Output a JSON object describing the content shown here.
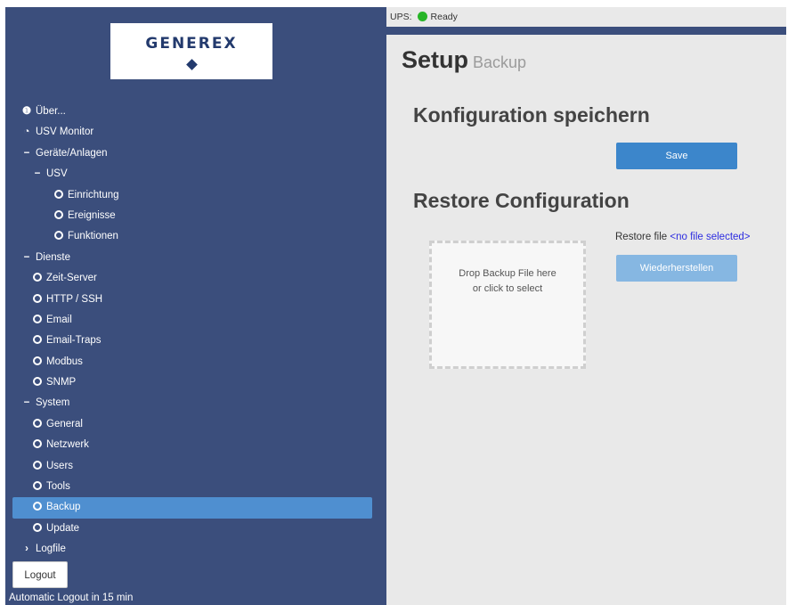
{
  "brand": {
    "logo_text": "GENEREX"
  },
  "sidebar": {
    "items": [
      {
        "label": "Über...",
        "icon": "info-icon"
      },
      {
        "label": "USV Monitor",
        "icon": "dashboard-icon"
      },
      {
        "label": "Geräte/Anlagen",
        "icon": "minus-icon"
      },
      {
        "label": "USV",
        "icon": "minus-icon"
      },
      {
        "label": "Einrichtung",
        "icon": "gear-icon"
      },
      {
        "label": "Ereignisse",
        "icon": "gear-icon"
      },
      {
        "label": "Funktionen",
        "icon": "gear-icon"
      },
      {
        "label": "Dienste",
        "icon": "minus-icon"
      },
      {
        "label": "Zeit-Server",
        "icon": "gear-icon"
      },
      {
        "label": "HTTP / SSH",
        "icon": "gear-icon"
      },
      {
        "label": "Email",
        "icon": "gear-icon"
      },
      {
        "label": "Email-Traps",
        "icon": "gear-icon"
      },
      {
        "label": "Modbus",
        "icon": "gear-icon"
      },
      {
        "label": "SNMP",
        "icon": "gear-icon"
      },
      {
        "label": "System",
        "icon": "minus-icon"
      },
      {
        "label": "General",
        "icon": "gear-icon"
      },
      {
        "label": "Netzwerk",
        "icon": "gear-icon"
      },
      {
        "label": "Users",
        "icon": "gear-icon"
      },
      {
        "label": "Tools",
        "icon": "gear-icon"
      },
      {
        "label": "Backup",
        "icon": "gear-icon"
      },
      {
        "label": "Update",
        "icon": "gear-icon"
      },
      {
        "label": "Logfile",
        "icon": "chevron-right-icon"
      }
    ],
    "logout_label": "Logout",
    "logout_note": "Automatic Logout in 15 min"
  },
  "status": {
    "label": "UPS:",
    "state": "Ready",
    "dot_color": "#27b527"
  },
  "page": {
    "title": "Setup",
    "subtitle": "Backup"
  },
  "save_section": {
    "heading": "Konfiguration speichern",
    "button": "Save"
  },
  "restore_section": {
    "heading": "Restore Configuration",
    "drop_line1": "Drop Backup File here",
    "drop_line2": "or click to select",
    "file_label": "Restore file",
    "file_value": "<no file selected>",
    "button": "Wiederherstellen"
  },
  "colors": {
    "sidebar_bg": "#3b4e7c",
    "active_item": "#4f8fd0",
    "save_button": "#3c86cb",
    "restore_button": "#86b7e2"
  }
}
